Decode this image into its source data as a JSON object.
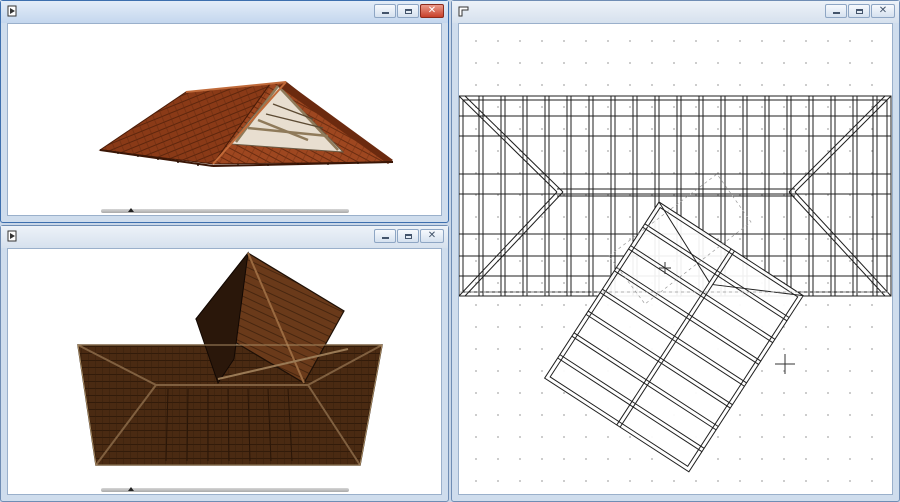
{
  "windows": {
    "perspective": {
      "icon": "camera-icon",
      "active": true
    },
    "axonometric": {
      "icon": "camera-icon",
      "active": false
    },
    "plan": {
      "icon": "floor-plan-icon",
      "active": false
    }
  },
  "buttons": {
    "minimize": "minimize-icon",
    "maximize": "maximize-icon",
    "close": "close-icon"
  },
  "colors": {
    "tile": "#8a3a17",
    "tile_light": "#b0552a",
    "tile_dark": "#5a2410",
    "axo_tile": "#4a2a12",
    "plan_lines": "#1f1f1f"
  }
}
